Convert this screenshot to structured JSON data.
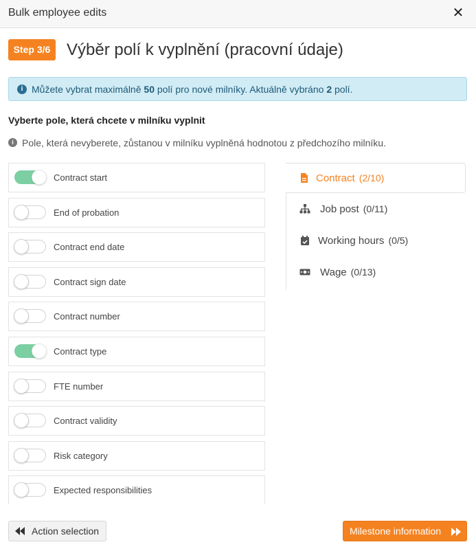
{
  "dialog": {
    "title": "Bulk employee edits",
    "close_glyph": "✕"
  },
  "step": {
    "badge": "Step 3/6",
    "title": "Výběr polí k vyplnění (pracovní údaje)"
  },
  "info": {
    "icon": "i",
    "text_before": "Můžete vybrat maximálně ",
    "max": "50",
    "text_middle": " polí pro nové milníky. Aktuálně vybráno ",
    "selected": "2",
    "text_after": " polí."
  },
  "section": {
    "title": "Vyberte pole, která chcete v milníku vyplnit",
    "hint_icon": "i",
    "hint": "Pole, která nevyberete, zůstanou v milníku vyplněná hodnotou z předchozího milníku."
  },
  "fields": [
    {
      "label": "Contract start",
      "on": true
    },
    {
      "label": "End of probation",
      "on": false
    },
    {
      "label": "Contract end date",
      "on": false
    },
    {
      "label": "Contract sign date",
      "on": false
    },
    {
      "label": "Contract number",
      "on": false
    },
    {
      "label": "Contract type",
      "on": true
    },
    {
      "label": "FTE number",
      "on": false
    },
    {
      "label": "Contract validity",
      "on": false
    },
    {
      "label": "Risk category",
      "on": false
    },
    {
      "label": "Expected responsibilities",
      "on": false
    }
  ],
  "tabs": [
    {
      "label": "Contract",
      "count": "(2/10)",
      "icon": "document-icon",
      "active": true
    },
    {
      "label": "Job post",
      "count": "(0/11)",
      "icon": "org-chart-icon",
      "active": false
    },
    {
      "label": "Working hours",
      "count": "(0/5)",
      "icon": "calendar-check-icon",
      "active": false
    },
    {
      "label": "Wage",
      "count": "(0/13)",
      "icon": "money-icon",
      "active": false
    }
  ],
  "footer": {
    "back_label": "Action selection",
    "next_label": "Milestone information"
  },
  "colors": {
    "accent": "#f58220",
    "toggle_on": "#7ccfa2",
    "info_bg": "#d1ecf5"
  }
}
